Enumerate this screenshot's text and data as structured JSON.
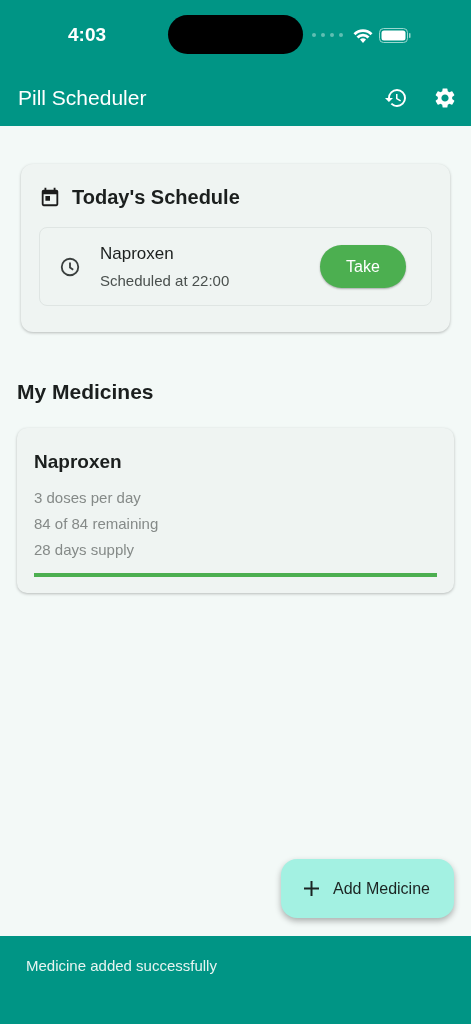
{
  "status_bar": {
    "time": "4:03"
  },
  "app_bar": {
    "title": "Pill Scheduler"
  },
  "schedule": {
    "title": "Today's Schedule",
    "doses": [
      {
        "name": "Naproxen",
        "time": "Scheduled at 22:00",
        "action": "Take"
      }
    ]
  },
  "medicines": {
    "title": "My Medicines",
    "items": [
      {
        "name": "Naproxen",
        "details": [
          "3 doses per day",
          "84 of 84 remaining",
          "28 days supply"
        ]
      }
    ]
  },
  "fab": {
    "label": "Add Medicine"
  },
  "snackbar": {
    "message": "Medicine added successfully"
  }
}
